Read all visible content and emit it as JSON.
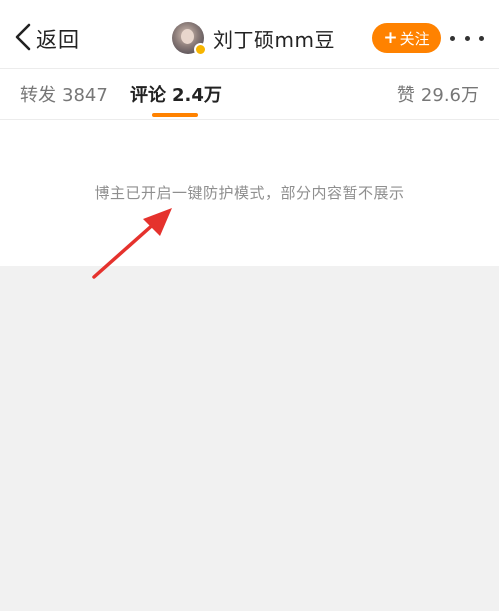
{
  "nav": {
    "back_label": "返回",
    "username": "刘丁硕mm豆",
    "follow_label": "关注",
    "follow_plus": "+"
  },
  "tabs": {
    "repost": {
      "label": "转发",
      "count": "3847"
    },
    "comment": {
      "label": "评论",
      "count": "2.4万",
      "active": true
    },
    "like": {
      "label": "赞",
      "count": "29.6万"
    }
  },
  "notice": {
    "text": "博主已开启一键防护模式，部分内容暂不展示"
  },
  "colors": {
    "accent": "#ff8200",
    "annotation_arrow": "#e5322d",
    "background": "#f1f1f1"
  },
  "icons": {
    "back": "chevron-left-icon",
    "more": "more-dots-icon",
    "verified": "verified-badge-icon"
  }
}
